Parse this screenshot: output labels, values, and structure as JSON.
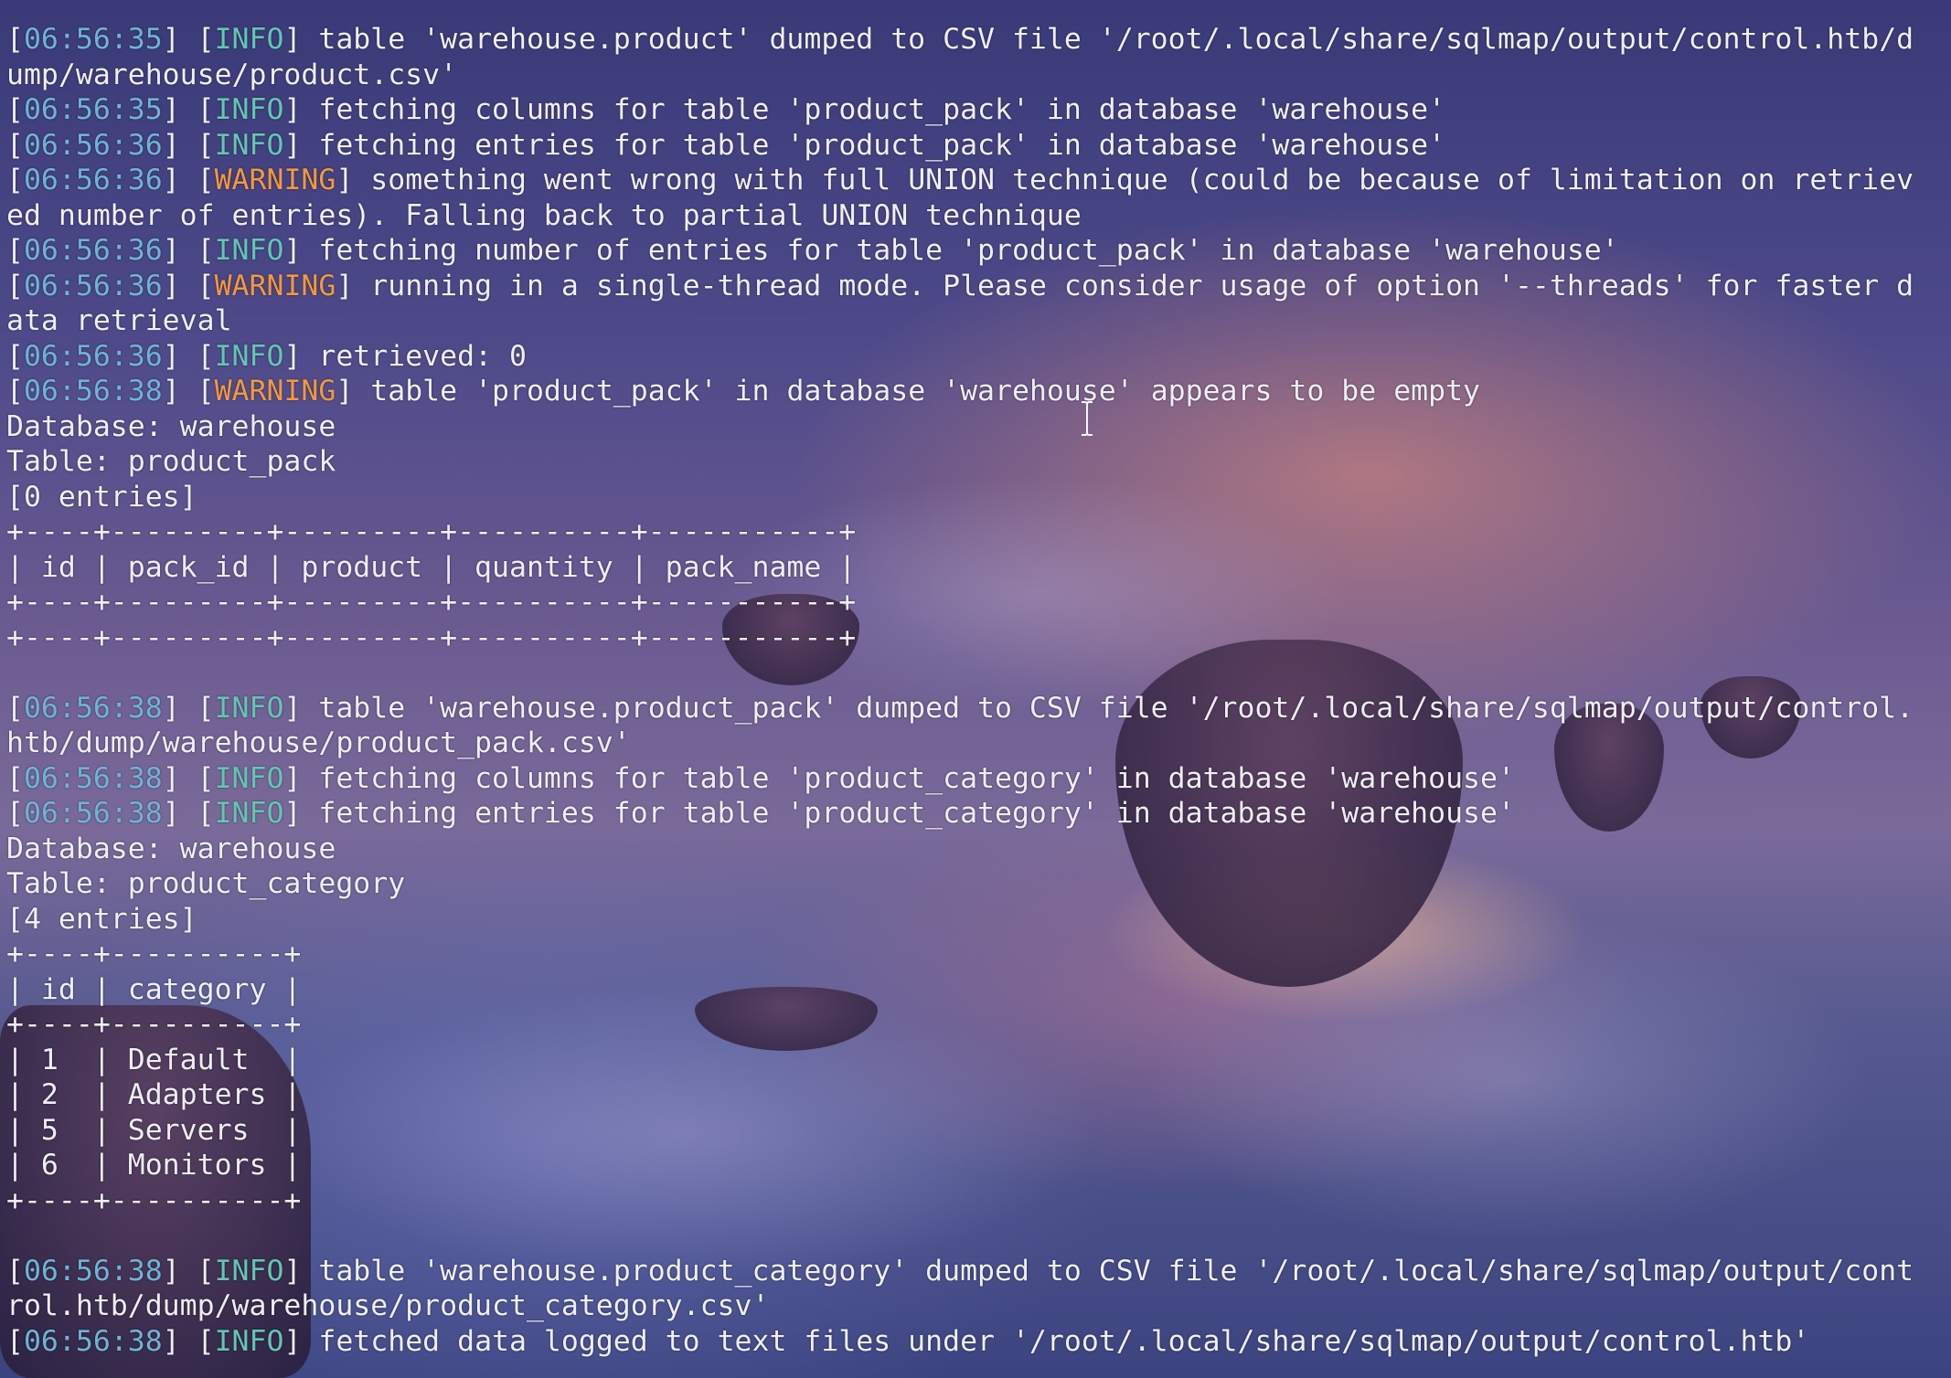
{
  "terminal": {
    "lines": [
      [
        {
          "t": "["
        },
        {
          "t": "06:56:35",
          "c": "ts"
        },
        {
          "t": "] ["
        },
        {
          "t": "INFO",
          "c": "info"
        },
        {
          "t": "] table 'warehouse.product' dumped to CSV file '/root/.local/share/sqlmap/output/control.htb/d"
        }
      ],
      [
        {
          "t": "ump/warehouse/product.csv'"
        }
      ],
      [
        {
          "t": "["
        },
        {
          "t": "06:56:35",
          "c": "ts"
        },
        {
          "t": "] ["
        },
        {
          "t": "INFO",
          "c": "info"
        },
        {
          "t": "] fetching columns for table 'product_pack' in database 'warehouse'"
        }
      ],
      [
        {
          "t": "["
        },
        {
          "t": "06:56:36",
          "c": "ts"
        },
        {
          "t": "] ["
        },
        {
          "t": "INFO",
          "c": "info"
        },
        {
          "t": "] fetching entries for table 'product_pack' in database 'warehouse'"
        }
      ],
      [
        {
          "t": "["
        },
        {
          "t": "06:56:36",
          "c": "ts"
        },
        {
          "t": "] ["
        },
        {
          "t": "WARNING",
          "c": "warn"
        },
        {
          "t": "] something went wrong with full UNION technique (could be because of limitation on retriev"
        }
      ],
      [
        {
          "t": "ed number of entries). Falling back to partial UNION technique"
        }
      ],
      [
        {
          "t": "["
        },
        {
          "t": "06:56:36",
          "c": "ts"
        },
        {
          "t": "] ["
        },
        {
          "t": "INFO",
          "c": "info"
        },
        {
          "t": "] fetching number of entries for table 'product_pack' in database 'warehouse'"
        }
      ],
      [
        {
          "t": "["
        },
        {
          "t": "06:56:36",
          "c": "ts"
        },
        {
          "t": "] ["
        },
        {
          "t": "WARNING",
          "c": "warn"
        },
        {
          "t": "] running in a single-thread mode. Please consider usage of option '--threads' for faster d"
        }
      ],
      [
        {
          "t": "ata retrieval"
        }
      ],
      [
        {
          "t": "["
        },
        {
          "t": "06:56:36",
          "c": "ts"
        },
        {
          "t": "] ["
        },
        {
          "t": "INFO",
          "c": "info"
        },
        {
          "t": "] retrieved: 0"
        }
      ],
      [
        {
          "t": "["
        },
        {
          "t": "06:56:38",
          "c": "ts"
        },
        {
          "t": "] ["
        },
        {
          "t": "WARNING",
          "c": "warn"
        },
        {
          "t": "] table 'product_pack' in database 'warehouse' appears to be empty"
        }
      ],
      [
        {
          "t": "Database: warehouse"
        }
      ],
      [
        {
          "t": "Table: product_pack"
        }
      ],
      [
        {
          "t": "[0 entries]"
        }
      ],
      [
        {
          "t": "+----+---------+---------+----------+-----------+"
        }
      ],
      [
        {
          "t": "| id | pack_id | product | quantity | pack_name |"
        }
      ],
      [
        {
          "t": "+----+---------+---------+----------+-----------+"
        }
      ],
      [
        {
          "t": "+----+---------+---------+----------+-----------+"
        }
      ],
      [
        {
          "t": ""
        }
      ],
      [
        {
          "t": "["
        },
        {
          "t": "06:56:38",
          "c": "ts"
        },
        {
          "t": "] ["
        },
        {
          "t": "INFO",
          "c": "info"
        },
        {
          "t": "] table 'warehouse.product_pack' dumped to CSV file '/root/.local/share/sqlmap/output/control."
        }
      ],
      [
        {
          "t": "htb/dump/warehouse/product_pack.csv'"
        }
      ],
      [
        {
          "t": "["
        },
        {
          "t": "06:56:38",
          "c": "ts"
        },
        {
          "t": "] ["
        },
        {
          "t": "INFO",
          "c": "info"
        },
        {
          "t": "] fetching columns for table 'product_category' in database 'warehouse'"
        }
      ],
      [
        {
          "t": "["
        },
        {
          "t": "06:56:38",
          "c": "ts"
        },
        {
          "t": "] ["
        },
        {
          "t": "INFO",
          "c": "info"
        },
        {
          "t": "] fetching entries for table 'product_category' in database 'warehouse'"
        }
      ],
      [
        {
          "t": "Database: warehouse"
        }
      ],
      [
        {
          "t": "Table: product_category"
        }
      ],
      [
        {
          "t": "[4 entries]"
        }
      ],
      [
        {
          "t": "+----+----------+"
        }
      ],
      [
        {
          "t": "| id | category |"
        }
      ],
      [
        {
          "t": "+----+----------+"
        }
      ],
      [
        {
          "t": "| 1  | Default  |"
        }
      ],
      [
        {
          "t": "| 2  | Adapters |"
        }
      ],
      [
        {
          "t": "| 5  | Servers  |"
        }
      ],
      [
        {
          "t": "| 6  | Monitors |"
        }
      ],
      [
        {
          "t": "+----+----------+"
        }
      ],
      [
        {
          "t": ""
        }
      ],
      [
        {
          "t": "["
        },
        {
          "t": "06:56:38",
          "c": "ts"
        },
        {
          "t": "] ["
        },
        {
          "t": "INFO",
          "c": "info"
        },
        {
          "t": "] table 'warehouse.product_category' dumped to CSV file '/root/.local/share/sqlmap/output/cont"
        }
      ],
      [
        {
          "t": "rol.htb/dump/warehouse/product_category.csv'"
        }
      ],
      [
        {
          "t": "["
        },
        {
          "t": "06:56:38",
          "c": "ts"
        },
        {
          "t": "] ["
        },
        {
          "t": "INFO",
          "c": "info"
        },
        {
          "t": "] fetched data logged to text files under '/root/.local/share/sqlmap/output/control.htb'"
        }
      ]
    ]
  },
  "colors": {
    "text": "#eeeef4",
    "timestamp": "#6fb3d6",
    "info": "#63c6b4",
    "warning": "#f2983f"
  },
  "cursor": {
    "icon": "i-beam-cursor-icon"
  }
}
